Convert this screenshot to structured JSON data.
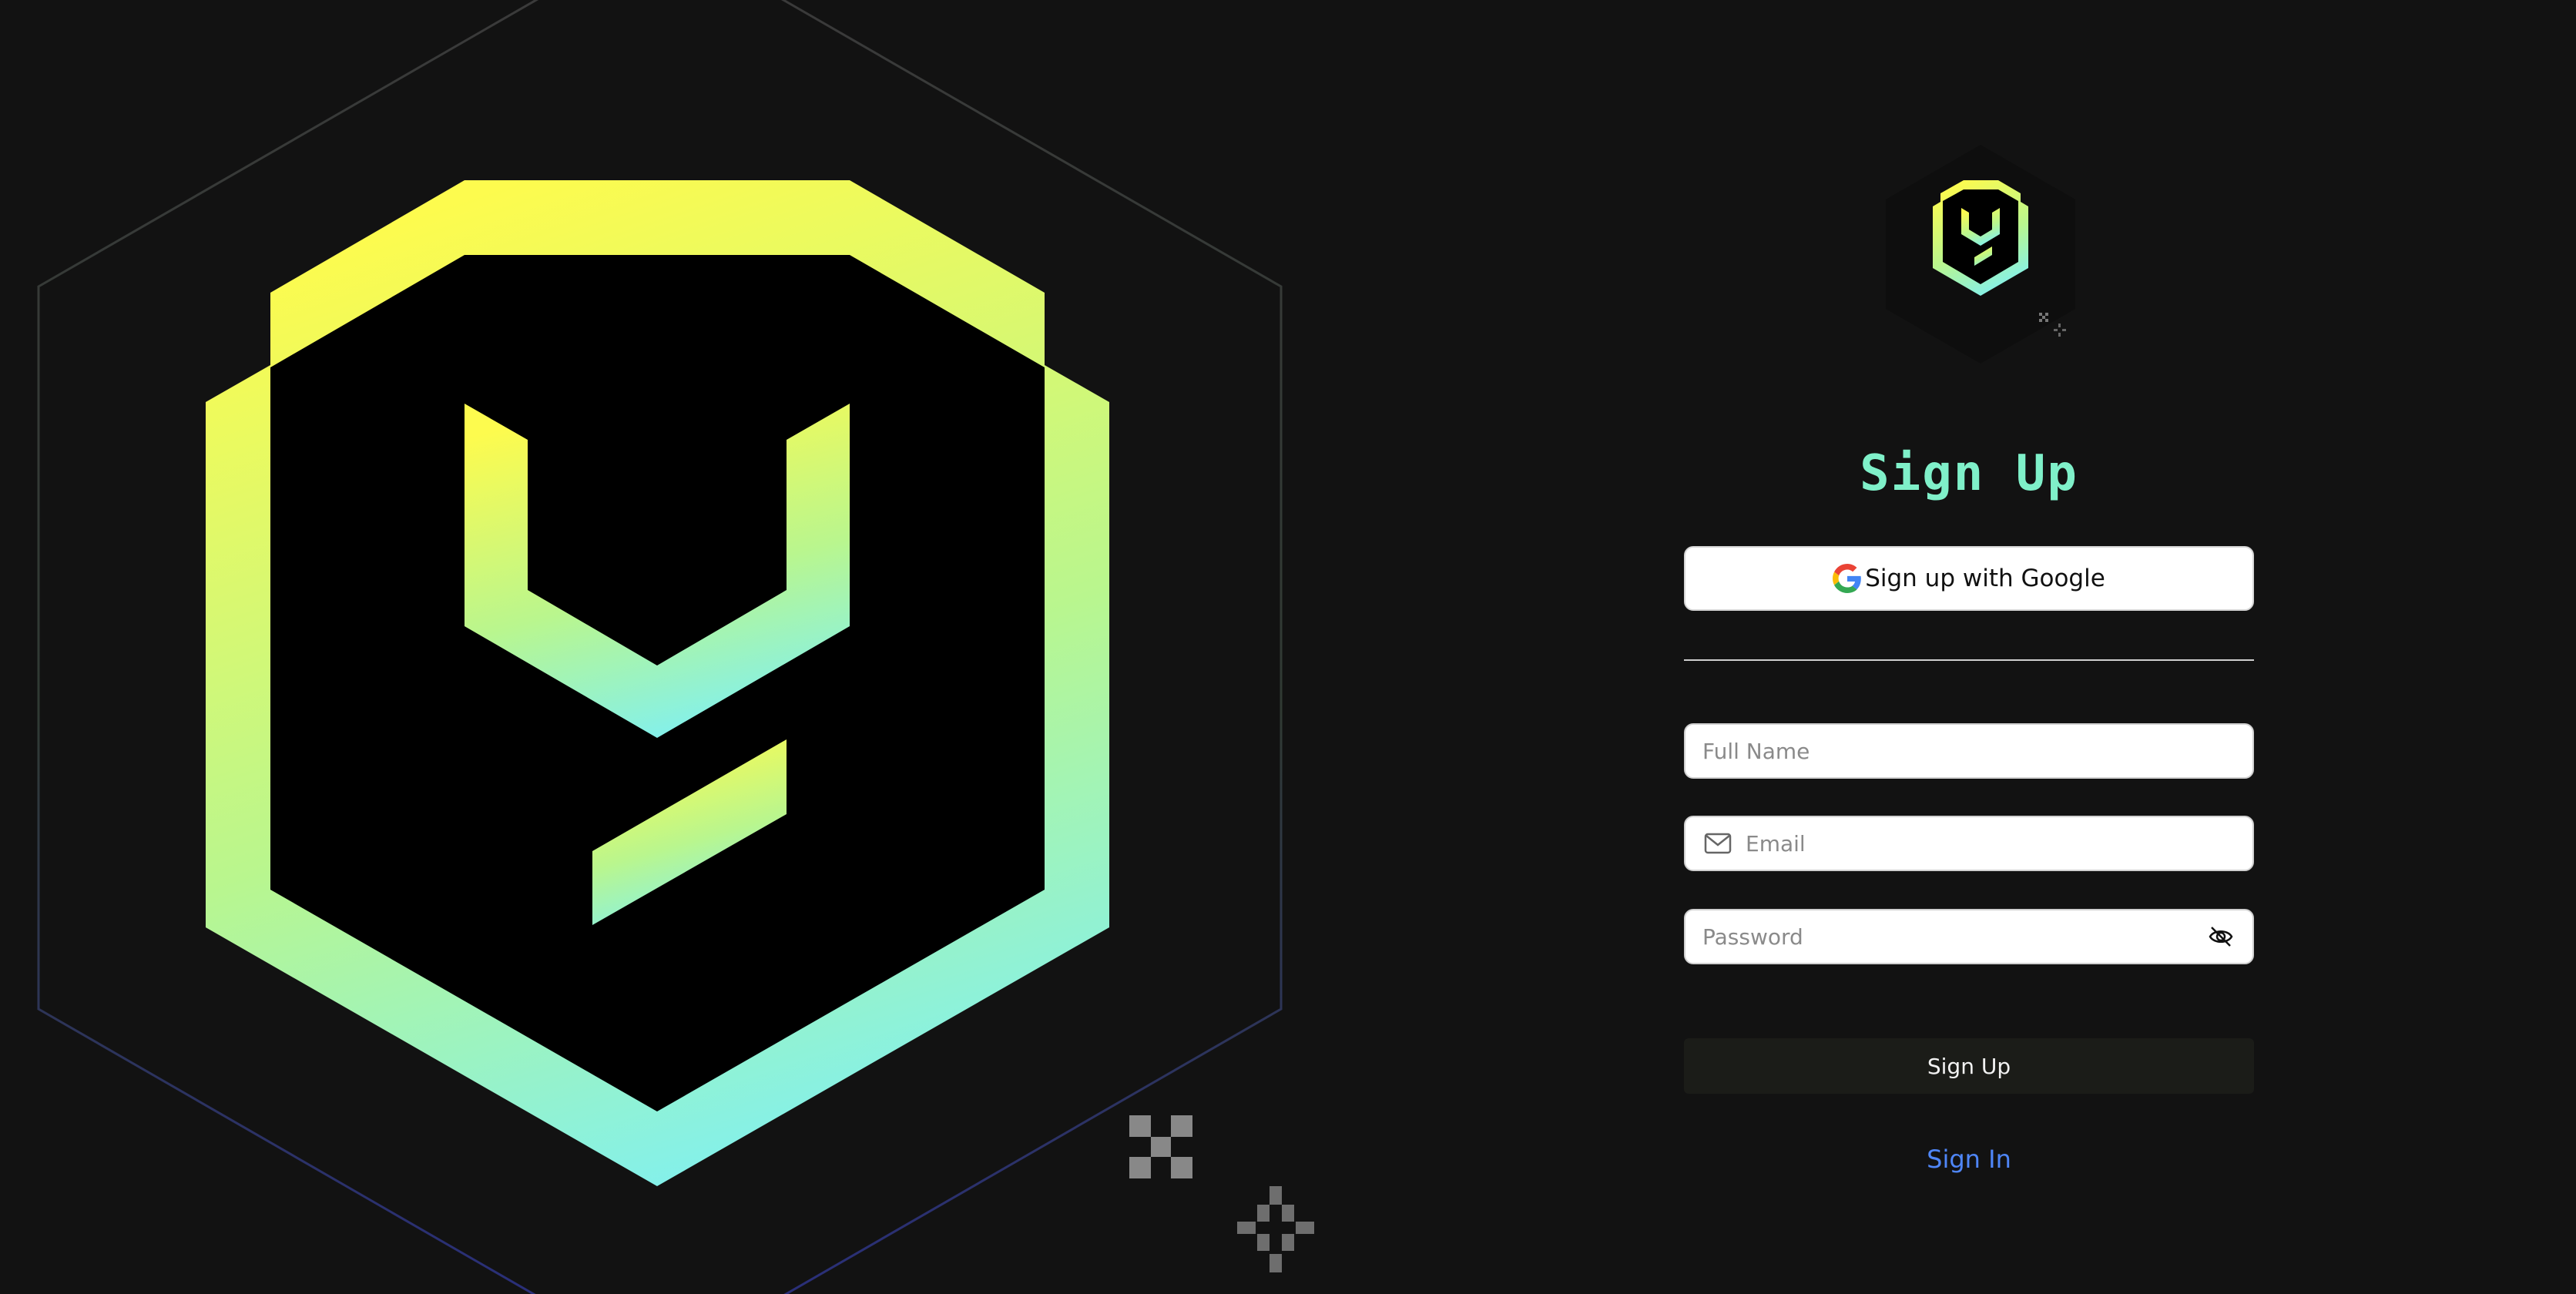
{
  "colors": {
    "background": "#121212",
    "title": "#7ff0c9",
    "gradient_top": "#fdfb4e",
    "gradient_bottom": "#7ff0f3",
    "link": "#4f86f7",
    "submit_bg": "#1b1c18"
  },
  "icons": {
    "hero_logo": "hexagon-y-logo",
    "small_logo": "hexagon-y-logo",
    "google": "google-g-icon",
    "email": "mail-icon",
    "password_toggle": "eye-off-icon",
    "decor": [
      "pixel-x-icon",
      "pixel-sparkle-icon"
    ]
  },
  "form": {
    "title": "Sign Up",
    "google_button": "Sign up with Google",
    "full_name_placeholder": "Full Name",
    "email_placeholder": "Email",
    "password_placeholder": "Password",
    "submit_label": "Sign Up",
    "signin_link": "Sign In"
  }
}
